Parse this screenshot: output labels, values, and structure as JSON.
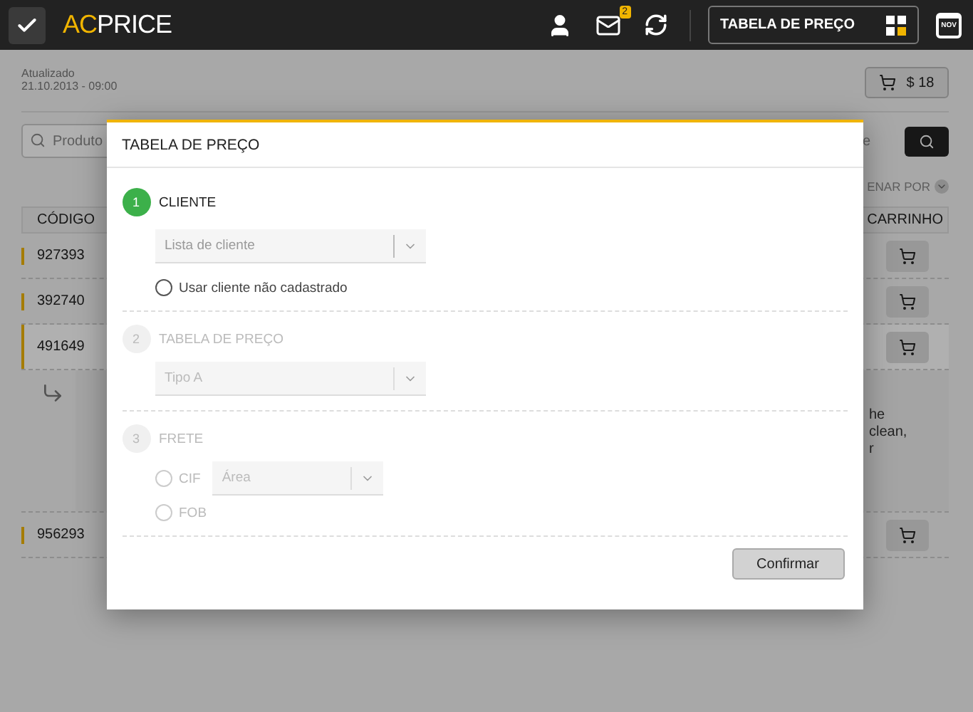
{
  "topbar": {
    "logo_accent": "AC",
    "logo_rest": "PRICE",
    "notification_count": "2",
    "price_table_button": "TABELA DE PREÇO",
    "calendar_month": "NOV"
  },
  "page": {
    "updated_label": "Atualizado",
    "updated_date": "21.10.2013 - 09:00",
    "cart_total": "$ 18",
    "search": {
      "placeholder": "Produto"
    },
    "search_partial": "e",
    "sort_partial": "ENAR POR",
    "columns": [
      "CÓDIGO",
      "CARRINHO"
    ],
    "rows": [
      {
        "code": "927393",
        "expanded": false
      },
      {
        "code": "392740",
        "expanded": false
      },
      {
        "code": "491649",
        "expanded": true,
        "detail_lines": [
          "he",
          "clean,",
          "r"
        ]
      },
      {
        "code": "956293",
        "expanded": false
      }
    ]
  },
  "modal": {
    "title": "TABELA DE PREÇO",
    "confirm": "Confirmar",
    "steps": [
      {
        "number": "1",
        "label": "CLIENTE",
        "active": true,
        "fields": [
          {
            "kind": "select",
            "placeholder": "Lista de cliente"
          },
          {
            "kind": "radio",
            "label": "Usar cliente não cadastrado",
            "selected": false
          }
        ]
      },
      {
        "number": "2",
        "label": "TABELA DE PREÇO",
        "active": false,
        "fields": [
          {
            "kind": "select",
            "value": "Tipo A"
          }
        ]
      },
      {
        "number": "3",
        "label": "FRETE",
        "active": false,
        "fields": [
          {
            "kind": "radio",
            "label": "CIF",
            "selected": false,
            "select": {
              "value": "Área"
            }
          },
          {
            "kind": "radio",
            "label": "FOB",
            "selected": false
          }
        ]
      }
    ]
  }
}
